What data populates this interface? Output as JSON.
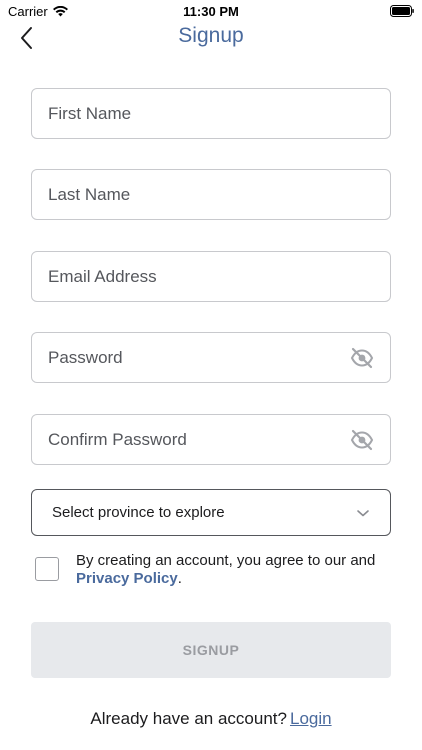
{
  "status_bar": {
    "carrier": "Carrier",
    "time": "11:30 PM",
    "wifi_icon": "wifi-icon",
    "battery_icon": "battery-full-icon"
  },
  "nav": {
    "back_icon": "chevron-left-icon",
    "title": "Signup"
  },
  "form": {
    "first_name": {
      "placeholder": "First Name",
      "value": ""
    },
    "last_name": {
      "placeholder": "Last Name",
      "value": ""
    },
    "email": {
      "placeholder": "Email Address",
      "value": ""
    },
    "password": {
      "placeholder": "Password",
      "value": "",
      "toggle_icon": "eye-off-icon"
    },
    "confirm_password": {
      "placeholder": "Confirm Password",
      "value": "",
      "toggle_icon": "eye-off-icon"
    },
    "province_select": {
      "label": "Select province to explore",
      "icon": "chevron-down-icon"
    }
  },
  "agreement": {
    "checked": false,
    "text_prefix": "By creating an account, you agree to our and",
    "link_text": "Privacy Policy",
    "text_suffix": "."
  },
  "signup_button": {
    "label": "SIGNUP",
    "enabled": false
  },
  "footer": {
    "prompt": "Already have an account?",
    "login_link": "Login"
  },
  "colors": {
    "accent": "#4a6a9d",
    "border": "#c8c9cd",
    "disabled_bg": "#e7e9ec",
    "disabled_text": "#9a9ca1"
  }
}
